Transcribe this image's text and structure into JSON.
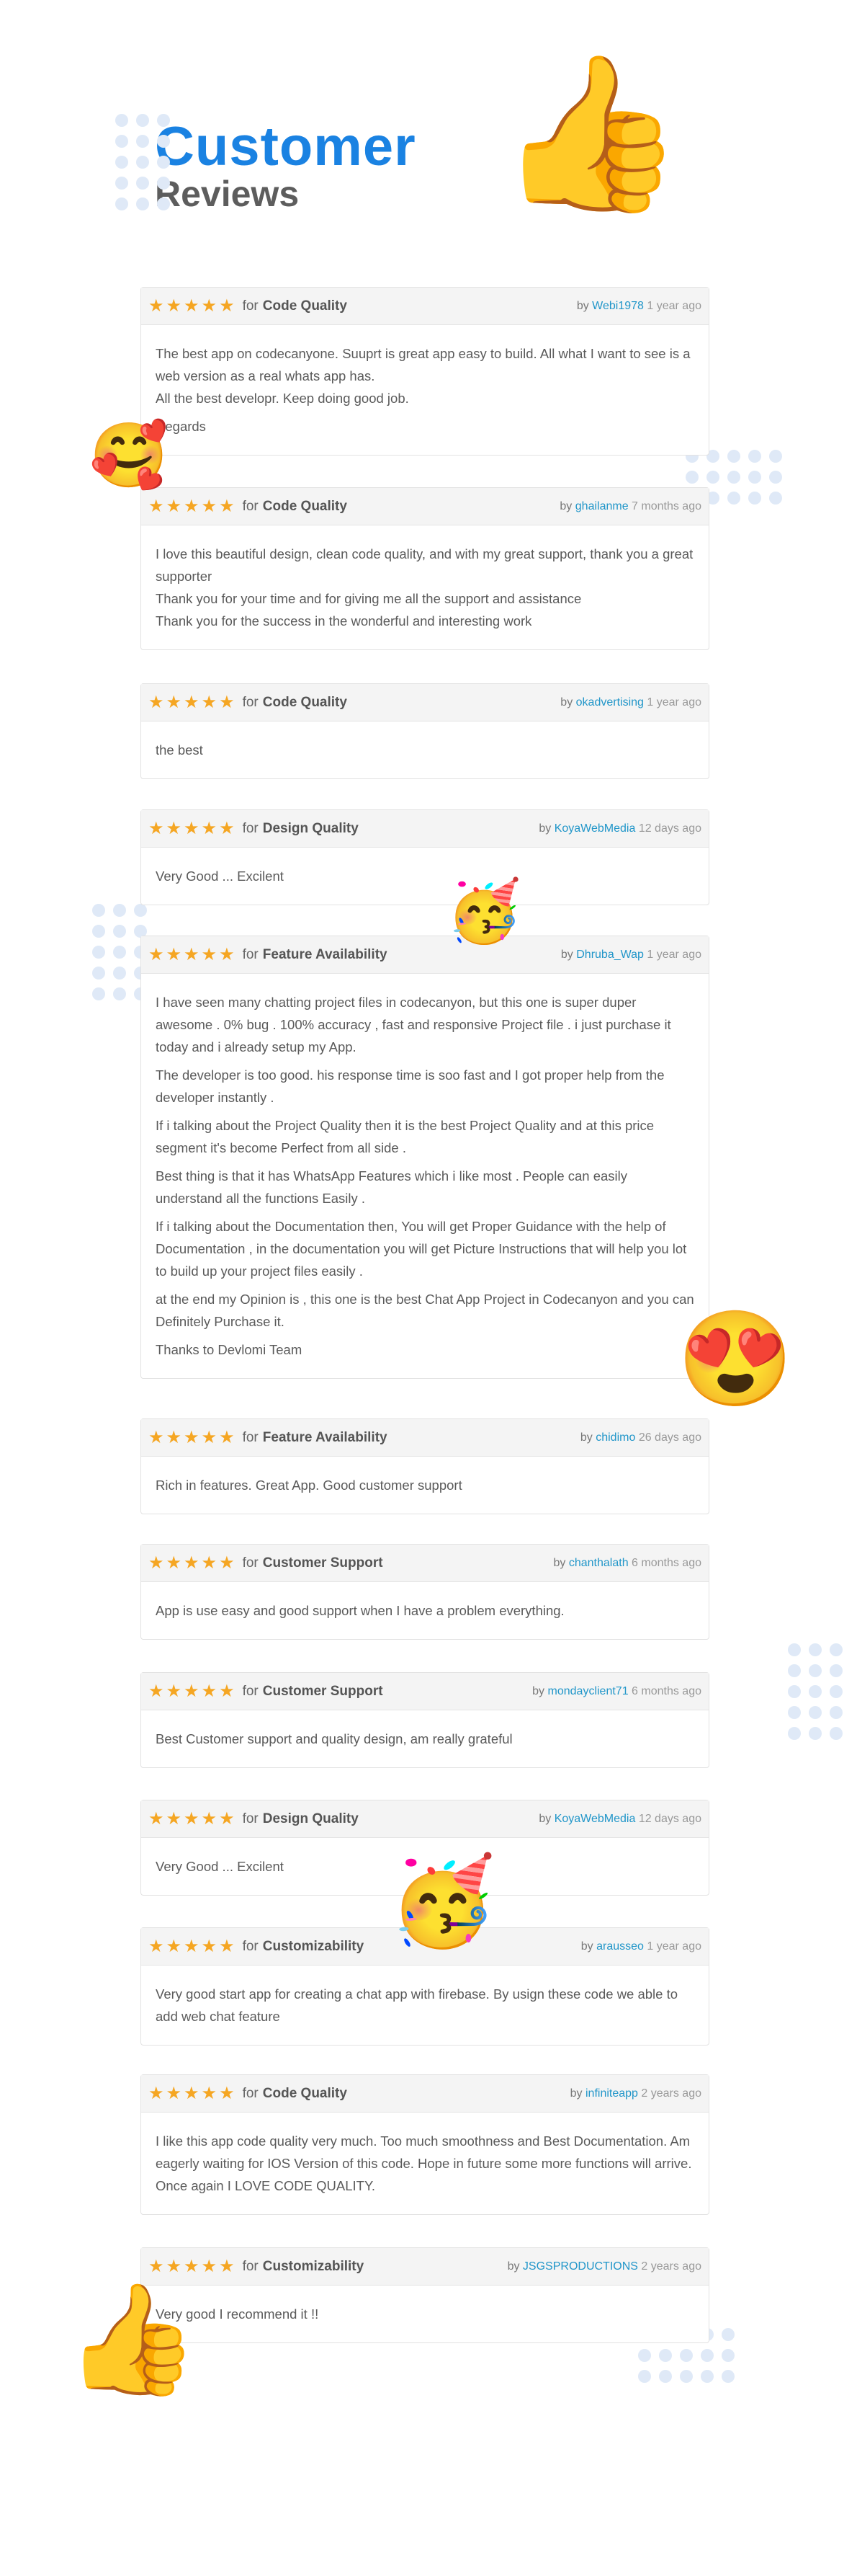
{
  "header": {
    "title": "Customer",
    "subtitle": "Reviews"
  },
  "reviews": [
    {
      "stars": "★★★★★",
      "for": "for",
      "category": "Code Quality",
      "by": "by",
      "author": "Webi1978",
      "time": "1 year ago",
      "paragraphs": [
        "The best app on codecanyone. Suuprt is great app easy to build. All what I want to see is a web version as a real whats app has.\nAll the best developr. Keep doing good job.",
        "Regards"
      ]
    },
    {
      "stars": "★★★★★",
      "for": "for",
      "category": "Code Quality",
      "by": "by",
      "author": "ghailanme",
      "time": "7 months ago",
      "paragraphs": [
        "I love this beautiful design, clean code quality, and with my great support, thank you a great supporter\nThank you for your time and for giving me all the support and assistance\nThank you for the success in the wonderful and interesting work"
      ]
    },
    {
      "stars": "★★★★★",
      "for": "for",
      "category": "Code Quality",
      "by": "by",
      "author": "okadvertising",
      "time": "1 year ago",
      "paragraphs": [
        "the best"
      ]
    },
    {
      "stars": "★★★★★",
      "for": "for",
      "category": "Design Quality",
      "by": "by",
      "author": "KoyaWebMedia",
      "time": "12 days ago",
      "paragraphs": [
        "Very Good ... Excilent"
      ]
    },
    {
      "stars": "★★★★★",
      "for": "for",
      "category": "Feature Availability",
      "by": "by",
      "author": "Dhruba_Wap",
      "time": "1 year ago",
      "paragraphs": [
        "I have seen many chatting project files in codecanyon, but this one is super duper awesome . 0% bug . 100% accuracy , fast and responsive Project file . i just purchase it today and i already setup my App.",
        "The developer is too good. his response time is soo fast and I got proper help from the developer instantly .",
        "If i talking about the Project Quality then it is the best Project Quality and at this price segment it's become Perfect from all side .",
        "Best thing is that it has WhatsApp Features which i like most . People can easily understand all the functions Easily .",
        "If i talking about the Documentation then, You will get Proper Guidance with the help of Documentation , in the documentation you will get Picture Instructions that will help you lot to build up your project files easily .",
        "at the end my Opinion is , this one is the best Chat App Project in Codecanyon and you can Definitely Purchase it.",
        "Thanks to Devlomi Team"
      ]
    },
    {
      "stars": "★★★★★",
      "for": "for",
      "category": "Feature Availability",
      "by": "by",
      "author": "chidimo",
      "time": "26 days ago",
      "paragraphs": [
        "Rich in features. Great App. Good customer support"
      ]
    },
    {
      "stars": "★★★★★",
      "for": "for",
      "category": "Customer Support",
      "by": "by",
      "author": "chanthalath",
      "time": "6 months ago",
      "paragraphs": [
        "App is use easy and good support when I have a problem everything."
      ]
    },
    {
      "stars": "★★★★★",
      "for": "for",
      "category": "Customer Support",
      "by": "by",
      "author": "mondayclient71",
      "time": "6 months ago",
      "paragraphs": [
        "Best Customer support and quality design, am really grateful"
      ]
    },
    {
      "stars": "★★★★★",
      "for": "for",
      "category": "Design Quality",
      "by": "by",
      "author": "KoyaWebMedia",
      "time": "12 days ago",
      "paragraphs": [
        "Very Good ... Excilent"
      ]
    },
    {
      "stars": "★★★★★",
      "for": "for",
      "category": "Customizability",
      "by": "by",
      "author": "arausseo",
      "time": "1 year ago",
      "paragraphs": [
        "Very good start app for creating a chat app with firebase. By usign these code we able to add web chat feature"
      ]
    },
    {
      "stars": "★★★★★",
      "for": "for",
      "category": "Code Quality",
      "by": "by",
      "author": "infiniteapp",
      "time": "2 years ago",
      "paragraphs": [
        "I like this app code quality very much. Too much smoothness and Best Documentation. Am eagerly waiting for IOS Version of this code. Hope in future some more functions will arrive. Once again I LOVE CODE QUALITY."
      ]
    },
    {
      "stars": "★★★★★",
      "for": "for",
      "category": "Customizability",
      "by": "by",
      "author": "JSGSPRODUCTIONS",
      "time": "2 years ago",
      "paragraphs": [
        "Very good I recommend it !!"
      ]
    }
  ],
  "decorations": {
    "thumbs_up_top": "👍",
    "smiling_hearts": "🥰",
    "party_face_1": "🥳",
    "heart_eyes": "😍",
    "party_face_2": "🥳",
    "thumbs_up_bottom": "👍"
  },
  "colors": {
    "accent": "#1a82e2",
    "star": "#f5a623",
    "author_link": "#2196c9",
    "dots": "#dfe9f7"
  }
}
